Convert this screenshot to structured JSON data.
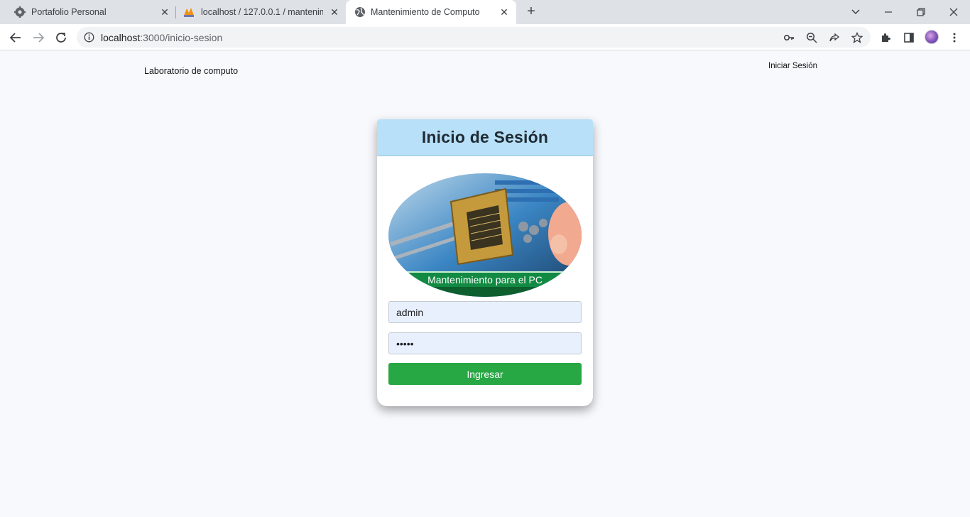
{
  "browser": {
    "tabs": [
      {
        "title": "Portafolio Personal",
        "active": false,
        "icon": "gear-icon"
      },
      {
        "title": "localhost / 127.0.0.1 / mantenimi",
        "active": false,
        "icon": "phpmyadmin-icon"
      },
      {
        "title": "Mantenimiento de Computo",
        "active": true,
        "icon": "globe-icon"
      }
    ],
    "url_host": "localhost",
    "url_path": ":3000/inicio-sesion"
  },
  "navbar": {
    "brand": "Laboratorio de computo",
    "login_link": "Iniciar Sesión"
  },
  "login": {
    "title": "Inicio de Sesión",
    "image_caption": "Mantenimiento para el PC",
    "username_value": "admin",
    "password_value": "•••••",
    "submit_label": "Ingresar"
  },
  "colors": {
    "header_bg": "#b8e0f8",
    "button_bg": "#28a745",
    "input_bg": "#e8f0fe",
    "page_bg": "#f8f9fd"
  }
}
